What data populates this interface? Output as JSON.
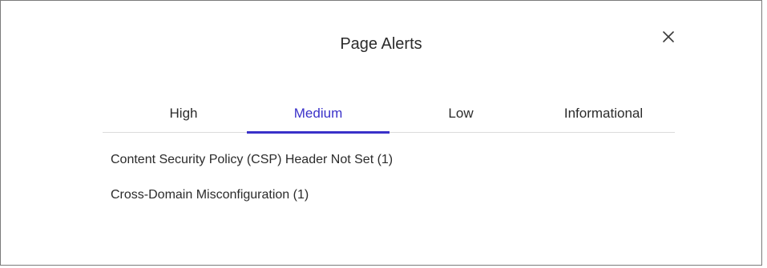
{
  "dialog": {
    "title": "Page Alerts",
    "close_icon": "close-icon"
  },
  "tabs": [
    {
      "label": "High",
      "active": false
    },
    {
      "label": "Medium",
      "active": true
    },
    {
      "label": "Low",
      "active": false
    },
    {
      "label": "Informational",
      "active": false
    }
  ],
  "alerts": [
    {
      "label": "Content Security Policy (CSP) Header Not Set (1)"
    },
    {
      "label": "Cross-Domain Misconfiguration (1)"
    }
  ],
  "colors": {
    "accent": "#3a31c9",
    "text": "#2b2b2b",
    "border": "#7b7b7b",
    "divider": "#dcdcdc"
  }
}
